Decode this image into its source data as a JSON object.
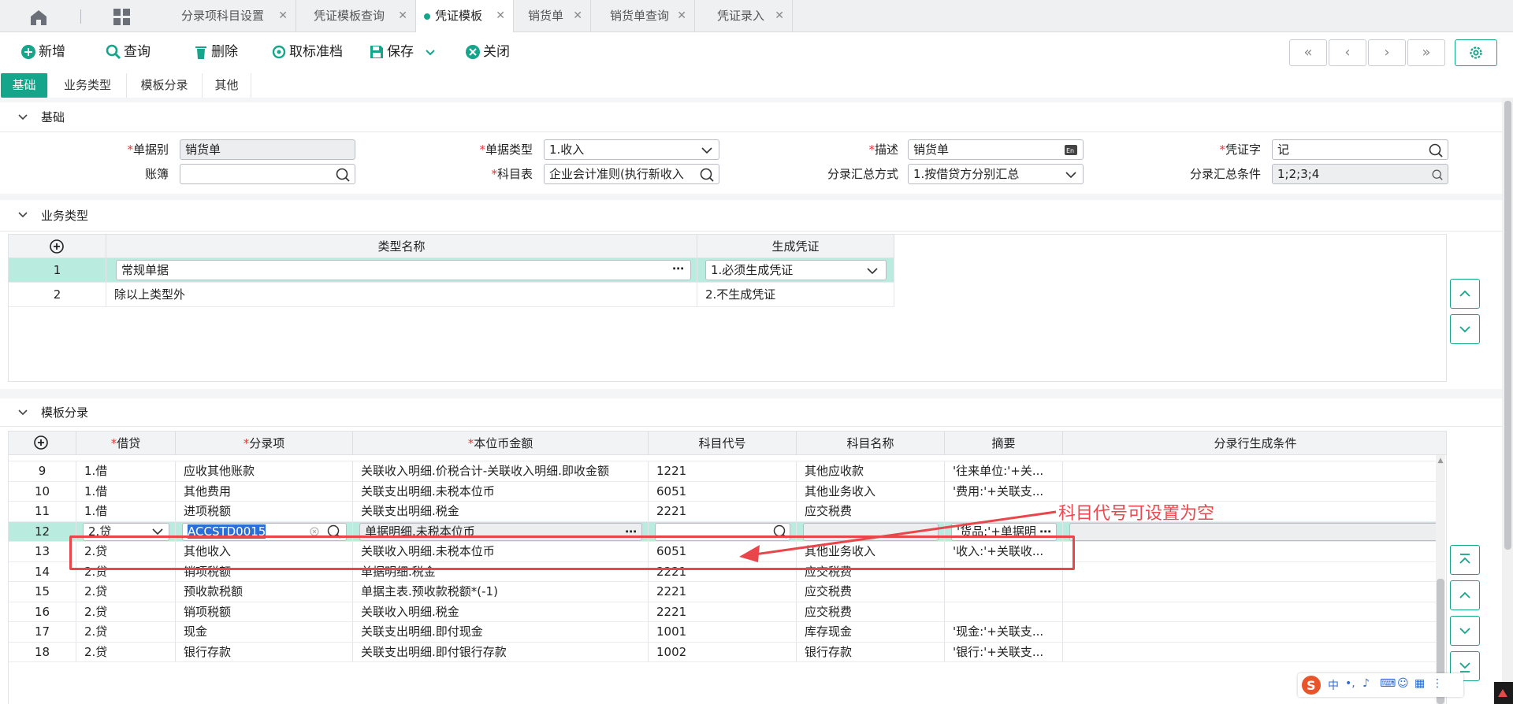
{
  "tabs": [
    {
      "label": "分录项科目设置",
      "active": false
    },
    {
      "label": "凭证模板查询",
      "active": false
    },
    {
      "label": "凭证模板",
      "active": true
    },
    {
      "label": "销货单",
      "active": false
    },
    {
      "label": "销货单查询",
      "active": false
    },
    {
      "label": "凭证录入",
      "active": false
    }
  ],
  "toolbar": {
    "add": "新增",
    "query": "查询",
    "delete": "删除",
    "unarchive": "取标准档",
    "save": "保存",
    "close": "关闭"
  },
  "subtabs": [
    "基础",
    "业务类型",
    "模板分录",
    "其他"
  ],
  "sections": {
    "basic": "基础",
    "biztype": "业务类型",
    "entries": "模板分录"
  },
  "form": {
    "doc_type_label": "单据别",
    "doc_type_value": "销货单",
    "ledger_label": "账簿",
    "ledger_value": "",
    "bill_kind_label": "单据类型",
    "bill_kind_value": "1.收入",
    "account_table_label": "科目表",
    "account_table_value": "企业会计准则(执行新收入",
    "desc_label": "描述",
    "desc_value": "销货单",
    "summary_method_label": "分录汇总方式",
    "summary_method_value": "1.按借贷方分别汇总",
    "voucher_word_label": "凭证字",
    "voucher_word_value": "记",
    "summary_cond_label": "分录汇总条件",
    "summary_cond_value": "1;2;3;4"
  },
  "biztype_grid": {
    "headers": [
      "类型名称",
      "生成凭证"
    ],
    "rows": [
      {
        "no": "1",
        "name": "常规单据",
        "gen": "1.必须生成凭证"
      },
      {
        "no": "2",
        "name": "除以上类型外",
        "gen": "2.不生成凭证"
      }
    ]
  },
  "entry_grid": {
    "headers": [
      "借贷",
      "分录项",
      "本位币金额",
      "科目代号",
      "科目名称",
      "摘要",
      "分录行生成条件"
    ],
    "rows": [
      {
        "no": "9",
        "dc": "1.借",
        "item": "应收其他账款",
        "amount": "关联收入明细.价税合计-关联收入明细.即收金额",
        "code": "1221",
        "name": "其他应收款",
        "memo": "'往来单位:'+关..."
      },
      {
        "no": "10",
        "dc": "1.借",
        "item": "其他费用",
        "amount": "关联支出明细.未税本位币",
        "code": "6051",
        "name": "其他业务收入",
        "memo": "'费用:'+关联支..."
      },
      {
        "no": "11",
        "dc": "1.借",
        "item": "进项税额",
        "amount": "关联支出明细.税金",
        "code": "2221",
        "name": "应交税费",
        "memo": ""
      },
      {
        "no": "12",
        "dc": "2.贷",
        "item": "ACCSTD0015",
        "amount": "单据明细.未税本位币",
        "code": "",
        "name": "",
        "memo": "'货品:'+单据明"
      },
      {
        "no": "13",
        "dc": "2.贷",
        "item": "其他收入",
        "amount": "关联收入明细.未税本位币",
        "code": "6051",
        "name": "其他业务收入",
        "memo": "'收入:'+关联收..."
      },
      {
        "no": "14",
        "dc": "2.贷",
        "item": "销项税额",
        "amount": "单据明细.税金",
        "code": "2221",
        "name": "应交税费",
        "memo": ""
      },
      {
        "no": "15",
        "dc": "2.贷",
        "item": "预收款税额",
        "amount": "单据主表.预收款税额*(-1)",
        "code": "2221",
        "name": "应交税费",
        "memo": ""
      },
      {
        "no": "16",
        "dc": "2.贷",
        "item": "销项税额",
        "amount": "关联收入明细.税金",
        "code": "2221",
        "name": "应交税费",
        "memo": ""
      },
      {
        "no": "17",
        "dc": "2.贷",
        "item": "现金",
        "amount": "关联支出明细.即付现金",
        "code": "1001",
        "name": "库存现金",
        "memo": "'现金:'+关联支..."
      },
      {
        "no": "18",
        "dc": "2.贷",
        "item": "银行存款",
        "amount": "关联支出明细.即付银行存款",
        "code": "1002",
        "name": "银行存款",
        "memo": "'银行:'+关联支..."
      }
    ]
  },
  "annotation": "科目代号可设置为空",
  "ime": {
    "lang": "中"
  },
  "colors": {
    "accent": "#14a58a",
    "annotation": "#e8464b",
    "required": "#e03b3b"
  }
}
